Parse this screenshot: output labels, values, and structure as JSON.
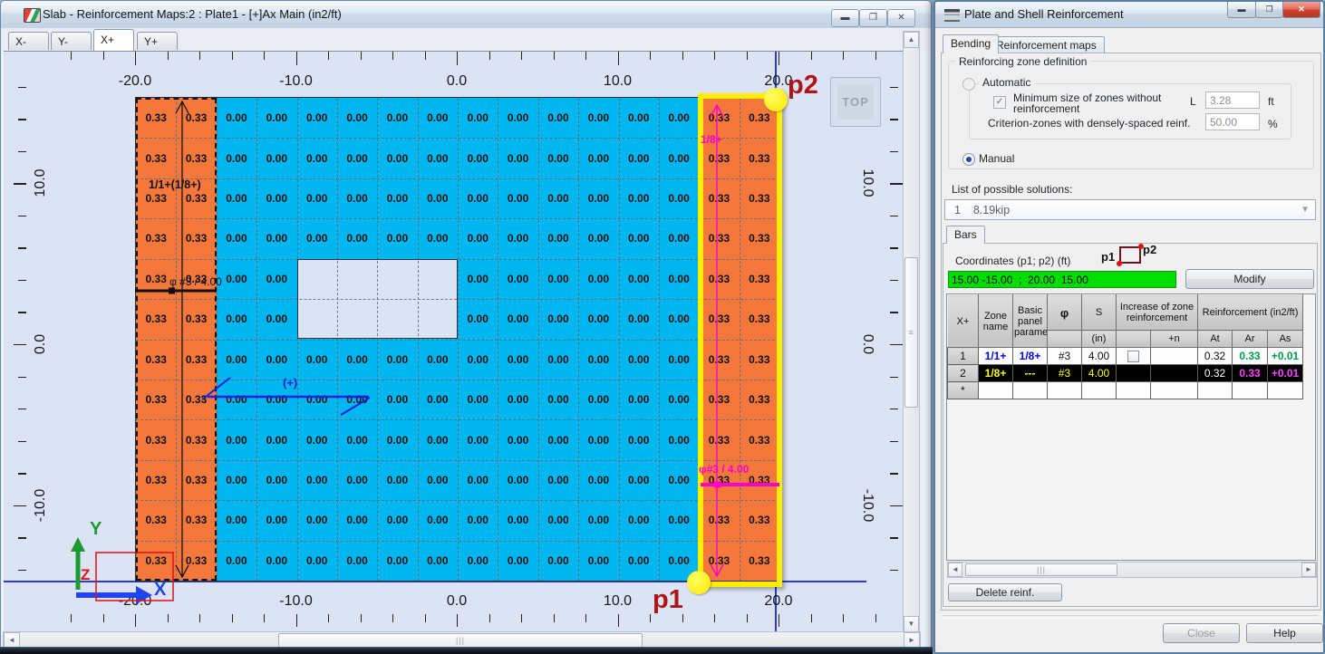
{
  "left_window": {
    "title": "Slab - Reinforcement Maps:2 : Plate1 - [+]Ax Main (in2/ft)",
    "tabs": [
      "X-",
      "Y-",
      "X+",
      "Y+"
    ],
    "active_tab": "X+",
    "view_button": "TOP",
    "axis": {
      "x_labels": [
        "-20.0",
        "-10.0",
        "0.0",
        "10.0",
        "20.0"
      ],
      "y_labels": [
        "10.0",
        "0.0",
        "-10.0"
      ]
    },
    "map": {
      "columns": 16,
      "rows": 12,
      "cells": [
        [
          "0.33",
          "0.33",
          "0.00",
          "0.00",
          "0.00",
          "0.00",
          "0.00",
          "0.00",
          "0.00",
          "0.00",
          "0.00",
          "0.00",
          "0.00",
          "0.00",
          "0.33",
          "0.33"
        ],
        [
          "0.33",
          "0.33",
          "0.00",
          "0.00",
          "0.00",
          "0.00",
          "0.00",
          "0.00",
          "0.00",
          "0.00",
          "0.00",
          "0.00",
          "0.00",
          "0.00",
          "0.33",
          "0.33"
        ],
        [
          "0.33",
          "0.33",
          "0.00",
          "0.00",
          "0.00",
          "0.00",
          "0.00",
          "0.00",
          "0.00",
          "0.00",
          "0.00",
          "0.00",
          "0.00",
          "0.00",
          "0.33",
          "0.33"
        ],
        [
          "0.33",
          "0.33",
          "0.00",
          "0.00",
          "0.00",
          "0.00",
          "0.00",
          "0.00",
          "0.00",
          "0.00",
          "0.00",
          "0.00",
          "0.00",
          "0.00",
          "0.33",
          "0.33"
        ],
        [
          "0.33",
          "0.33",
          "0.00",
          "0.00",
          null,
          null,
          null,
          null,
          "0.00",
          "0.00",
          "0.00",
          "0.00",
          "0.00",
          "0.00",
          "0.33",
          "0.33"
        ],
        [
          "0.33",
          "0.33",
          "0.00",
          "0.00",
          null,
          null,
          null,
          null,
          "0.00",
          "0.00",
          "0.00",
          "0.00",
          "0.00",
          "0.00",
          "0.33",
          "0.33"
        ],
        [
          "0.33",
          "0.33",
          "0.00",
          "0.00",
          "0.00",
          "0.00",
          "0.00",
          "0.00",
          "0.00",
          "0.00",
          "0.00",
          "0.00",
          "0.00",
          "0.00",
          "0.33",
          "0.33"
        ],
        [
          "0.33",
          "0.33",
          "0.00",
          "0.00",
          "0.00",
          "0.00",
          "0.00",
          "0.00",
          "0.00",
          "0.00",
          "0.00",
          "0.00",
          "0.00",
          "0.00",
          "0.33",
          "0.33"
        ],
        [
          "0.33",
          "0.33",
          "0.00",
          "0.00",
          "0.00",
          "0.00",
          "0.00",
          "0.00",
          "0.00",
          "0.00",
          "0.00",
          "0.00",
          "0.00",
          "0.00",
          "0.33",
          "0.33"
        ],
        [
          "0.33",
          "0.33",
          "0.00",
          "0.00",
          "0.00",
          "0.00",
          "0.00",
          "0.00",
          "0.00",
          "0.00",
          "0.00",
          "0.00",
          "0.00",
          "0.00",
          "0.33",
          "0.33"
        ],
        [
          "0.33",
          "0.33",
          "0.00",
          "0.00",
          "0.00",
          "0.00",
          "0.00",
          "0.00",
          "0.00",
          "0.00",
          "0.00",
          "0.00",
          "0.00",
          "0.00",
          "0.33",
          "0.33"
        ],
        [
          "0.33",
          "0.33",
          "0.00",
          "0.00",
          "0.00",
          "0.00",
          "0.00",
          "0.00",
          "0.00",
          "0.00",
          "0.00",
          "0.00",
          "0.00",
          "0.00",
          "0.33",
          "0.33"
        ]
      ],
      "annotations": {
        "left_zone_label": "1/1+(1/8+)",
        "left_zone_bar_label": "φ #3 / 4.00",
        "right_zone_label": "1/8+",
        "right_zone_bar_label": "φ#3 / 4.00",
        "section_sign": "(+)",
        "p1": "p1",
        "p2": "p2"
      },
      "triad": {
        "x": "X",
        "y": "Y",
        "z": "Z"
      }
    }
  },
  "panel": {
    "title": "Plate and Shell Reinforcement",
    "tabs": [
      "Bending",
      "Reinforcement maps"
    ],
    "active_tab": "Bending",
    "zone_definition": {
      "group_label": "Reinforcing zone definition",
      "automatic_label": "Automatic",
      "min_size_label": "Minimum size of zones without reinforcement",
      "L_label": "L",
      "L_value": "3.28",
      "L_unit": "ft",
      "criterion_label": "Criterion-zones with densely-spaced reinf.",
      "criterion_value": "50.00",
      "criterion_unit": "%",
      "manual_label": "Manual"
    },
    "solutions": {
      "label": "List of possible solutions:",
      "selected": "1    8.19kip"
    },
    "bars": {
      "tab_label": "Bars",
      "coordinates_label": "Coordinates (p1; p2) (ft)",
      "p1": "p1",
      "p2": "p2",
      "coordinates_value": "15.00 -15.00  ;  20.00  15.00",
      "modify_button": "Modify",
      "table": {
        "corner": "X+",
        "headers": {
          "zone": "Zone name",
          "basic": "Basic panel parameters",
          "phi": "φ",
          "s": "S",
          "s_sub": "(in)",
          "increase": "Increase of zone reinforcement",
          "n_sub": "+n",
          "reinforcement": "Reinforcement (in2/ft)",
          "at": "At",
          "ar": "Ar",
          "as": "As"
        },
        "rows": [
          {
            "num": "1",
            "zone": "1/1+",
            "basic": "1/8+",
            "phi": "#3",
            "s": "4.00",
            "has_checkbox": true,
            "n": "",
            "at": "0.32",
            "ar": "0.33",
            "as": "+0.01",
            "selected": false,
            "zone_color": "#0000e8",
            "value_color": "#101010",
            "at_color": "#101010",
            "reinf_color": "#009a4d"
          },
          {
            "num": "2",
            "zone": "1/8+",
            "basic": "---",
            "phi": "#3",
            "s": "4.00",
            "has_checkbox": false,
            "n": "",
            "at": "0.32",
            "ar": "0.33",
            "as": "+0.01",
            "selected": true,
            "zone_color": "#ffff00",
            "value_color": "#ffff00",
            "at_color": "#ffffff",
            "reinf_color": "#ff44ff"
          },
          {
            "num": "*",
            "zone": "",
            "basic": "",
            "phi": "",
            "s": "",
            "has_checkbox": false,
            "n": "",
            "at": "",
            "ar": "",
            "as": "",
            "selected": false,
            "zone_color": "#101010",
            "value_color": "#101010",
            "at_color": "#101010",
            "reinf_color": "#101010"
          }
        ]
      },
      "delete_button": "Delete reinf."
    },
    "close_button": "Close",
    "help_button": "Help"
  },
  "colors": {
    "slab": "#00b6ef",
    "zone_orange": "#f4783c",
    "selection_yellow": "#ffee00",
    "marker_magenta": "#ff00cc",
    "construction_blue": "#2a3cc4",
    "accent_red": "#b01414",
    "coords_green": "#00dd00"
  }
}
